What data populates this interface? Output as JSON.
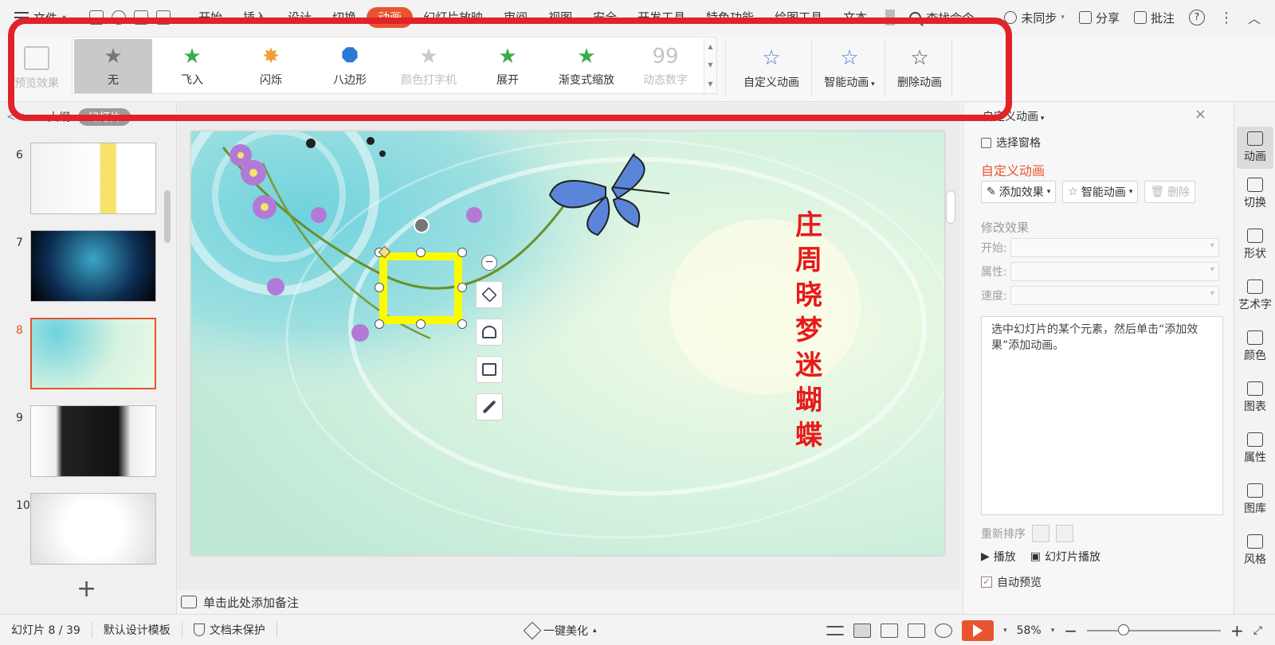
{
  "menubar": {
    "file_label": "文件",
    "tabs": [
      {
        "label": "开始"
      },
      {
        "label": "插入"
      },
      {
        "label": "设计"
      },
      {
        "label": "切换"
      },
      {
        "label": "动画",
        "active": true
      },
      {
        "label": "幻灯片放映"
      },
      {
        "label": "审阅"
      },
      {
        "label": "视图"
      },
      {
        "label": "安全"
      },
      {
        "label": "开发工具"
      },
      {
        "label": "特色功能"
      },
      {
        "label": "绘图工具"
      },
      {
        "label": "文本"
      }
    ],
    "search_label": "查找命令",
    "sync_label": "未同步",
    "share_label": "分享",
    "annotate_label": "批注",
    "help_icon": "?",
    "more_icon": "⋮",
    "collapse_icon": "︿"
  },
  "ribbon": {
    "preview_label": "预览效果",
    "gallery": [
      {
        "label": "无",
        "icon": "star-gray-icon",
        "selected": true,
        "disabled": false
      },
      {
        "label": "飞入",
        "icon": "fly-in-star-icon",
        "selected": false,
        "disabled": false
      },
      {
        "label": "闪烁",
        "icon": "flash-star-icon",
        "selected": false,
        "disabled": false
      },
      {
        "label": "八边形",
        "icon": "octagon-icon",
        "selected": false,
        "disabled": false
      },
      {
        "label": "颜色打字机",
        "icon": "typewriter-star-icon",
        "selected": false,
        "disabled": true
      },
      {
        "label": "展开",
        "icon": "expand-star-icon",
        "selected": false,
        "disabled": false
      },
      {
        "label": "渐变式缩放",
        "icon": "zoom-star-icon",
        "selected": false,
        "disabled": false
      },
      {
        "label": "动态数字",
        "icon": "dynamic-number-icon",
        "selected": false,
        "disabled": true
      }
    ],
    "custom_anim_label": "自定义动画",
    "smart_anim_label": "智能动画",
    "delete_anim_label": "删除动画"
  },
  "left_pane": {
    "outline_label": "大纲",
    "slides_label": "幻灯片",
    "thumbnails": [
      {
        "num": "6",
        "current": false
      },
      {
        "num": "7",
        "current": false
      },
      {
        "num": "8",
        "current": true
      },
      {
        "num": "9",
        "current": false
      },
      {
        "num": "10",
        "current": false
      }
    ],
    "add_label": "+"
  },
  "slide": {
    "vertical_title": [
      "庄",
      "周",
      "晓",
      "梦",
      "迷",
      "蝴",
      "蝶"
    ]
  },
  "notes": {
    "placeholder": "单击此处添加备注"
  },
  "task_pane": {
    "title": "自定义动画",
    "select_pane_label": "选择窗格",
    "section_title": "自定义动画",
    "add_effect_label": "添加效果",
    "smart_anim_label": "智能动画",
    "delete_label": "删除",
    "modify_label": "修改效果",
    "start_label": "开始:",
    "property_label": "属性:",
    "speed_label": "速度:",
    "hint_text": "选中幻灯片的某个元素，然后单击“添加效果”添加动画。",
    "reorder_label": "重新排序",
    "play_label": "播放",
    "slideshow_label": "幻灯片播放",
    "auto_preview_label": "自动预览"
  },
  "right_toolbar": [
    {
      "label": "动画",
      "icon": "animation-star-icon",
      "active": true
    },
    {
      "label": "切换",
      "icon": "switch-icon",
      "active": false
    },
    {
      "label": "形状",
      "icon": "shape-icon",
      "active": false
    },
    {
      "label": "艺术字",
      "icon": "word-art-icon",
      "active": false
    },
    {
      "label": "颜色",
      "icon": "color-icon",
      "active": false
    },
    {
      "label": "图表",
      "icon": "chart-icon",
      "active": false
    },
    {
      "label": "属性",
      "icon": "properties-icon",
      "active": false
    },
    {
      "label": "图库",
      "icon": "gallery-icon",
      "active": false
    },
    {
      "label": "风格",
      "icon": "style-icon",
      "active": false
    }
  ],
  "statusbar": {
    "slide_counter": "幻灯片 8 / 39",
    "template": "默认设计模板",
    "protect": "文档未保护",
    "beautify": "一键美化",
    "zoom": "58%",
    "zoom_level": 0.58
  },
  "colors": {
    "accent": "#e8542f",
    "highlight_box": "#e12228",
    "selection": "#fbfb00",
    "slide_title": "#e71a1a"
  }
}
